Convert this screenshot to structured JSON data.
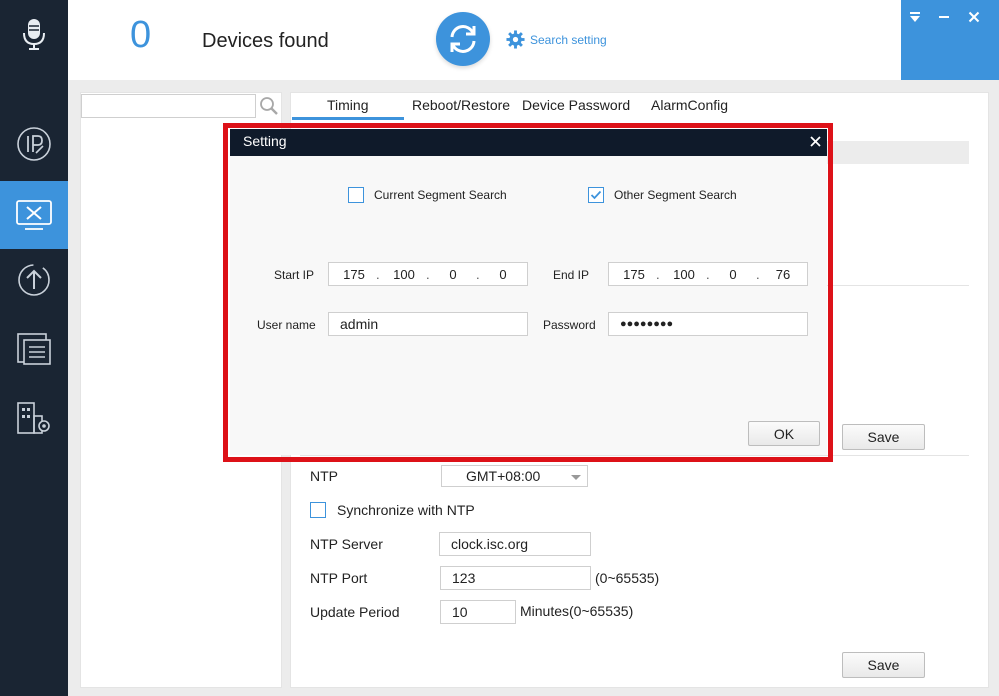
{
  "header": {
    "device_count": "0",
    "devices_found_label": "Devices found",
    "search_setting_label": "Search setting"
  },
  "sidebar": {
    "items": [
      {
        "icon": "microphone-icon"
      },
      {
        "icon": "ip-icon"
      },
      {
        "icon": "device-config-icon",
        "active": true
      },
      {
        "icon": "upgrade-icon"
      },
      {
        "icon": "document-list-icon"
      },
      {
        "icon": "building-settings-icon"
      }
    ]
  },
  "left_panel": {
    "search_value": "",
    "search_icon": "search-icon"
  },
  "tabs": [
    {
      "label": "Timing",
      "active": true
    },
    {
      "label": "Reboot/Restore"
    },
    {
      "label": "Device Password"
    },
    {
      "label": "AlarmConfig"
    }
  ],
  "timing": {
    "save_label": "Save",
    "ntp_label": "NTP",
    "timezone_value": "GMT+08:00",
    "sync_label": "Synchronize with NTP",
    "sync_checked": false,
    "ntp_server_label": "NTP Server",
    "ntp_server_value": "clock.isc.org",
    "ntp_port_label": "NTP Port",
    "ntp_port_value": "123",
    "ntp_port_range": "(0~65535)",
    "update_period_label": "Update Period",
    "update_period_value": "10",
    "update_period_unit": "Minutes(0~65535)",
    "save2_label": "Save"
  },
  "modal": {
    "title": "Setting",
    "current_segment_label": "Current Segment Search",
    "current_segment_checked": false,
    "other_segment_label": "Other Segment Search",
    "other_segment_checked": true,
    "start_ip_label": "Start IP",
    "start_ip": [
      "175",
      "100",
      "0",
      "0"
    ],
    "end_ip_label": "End IP",
    "end_ip": [
      "175",
      "100",
      "0",
      "76"
    ],
    "username_label": "User name",
    "username_value": "admin",
    "password_label": "Password",
    "password_value": "●●●●●●●●",
    "ok_label": "OK"
  },
  "colors": {
    "accent": "#3d93dc",
    "sidebar_bg": "#1a2533",
    "modal_title_bg": "#0f1a2a",
    "highlight_border": "#dd1118"
  }
}
